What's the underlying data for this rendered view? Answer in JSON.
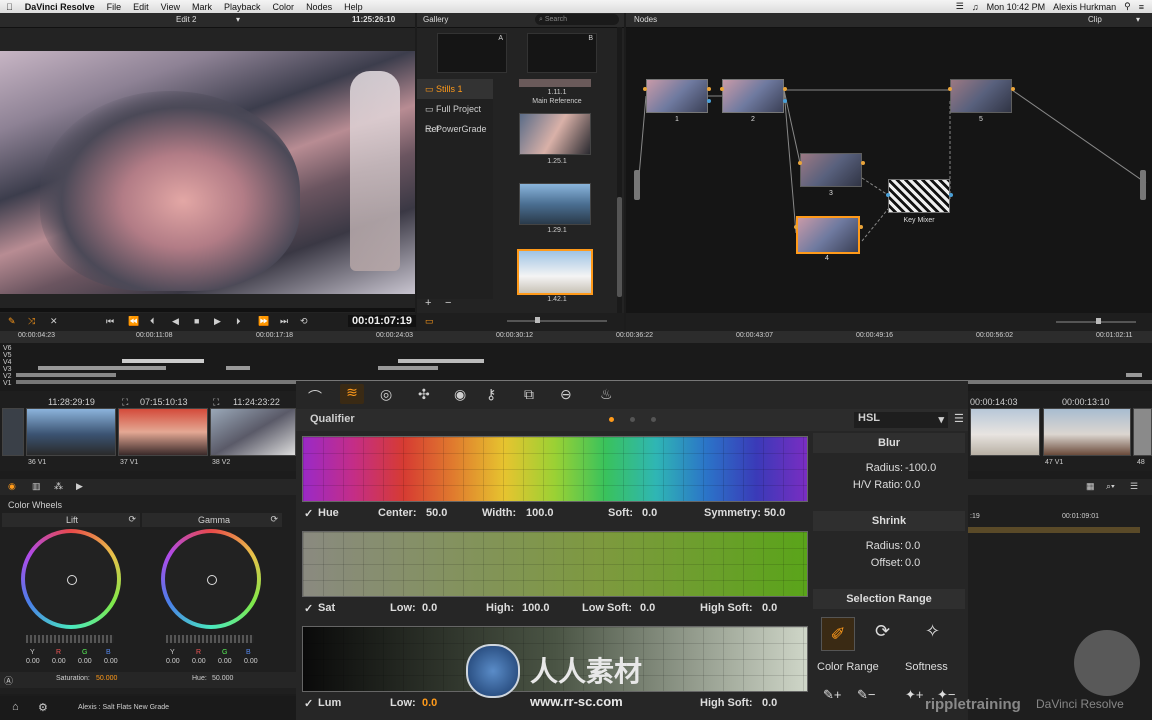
{
  "menubar": {
    "app": "DaVinci Resolve",
    "items": [
      "File",
      "Edit",
      "View",
      "Mark",
      "Playback",
      "Color",
      "Nodes",
      "Help"
    ],
    "clock": "Mon 10:42 PM",
    "user": "Alexis Hurkman"
  },
  "viewer": {
    "edit_name": "Edit 2",
    "timecode_top": "11:25:26:10",
    "timecode_bottom": "00:01:07:19"
  },
  "gallery": {
    "title": "Gallery",
    "search_placeholder": "Search",
    "slot_a": "A",
    "slot_b": "B",
    "albums": [
      "Stills 1",
      "Full Project Ref",
      "PowerGrade"
    ],
    "stills": [
      {
        "id": "1.11.1",
        "label": "Main Reference"
      },
      {
        "id": "1.25.1",
        "label": ""
      },
      {
        "id": "1.29.1",
        "label": ""
      },
      {
        "id": "1.42.1",
        "label": ""
      }
    ],
    "add": "+",
    "remove": "−"
  },
  "nodes": {
    "title": "Nodes",
    "mode": "Clip",
    "labels": [
      "1",
      "2",
      "3",
      "4",
      "5",
      "Key Mixer"
    ]
  },
  "timeline": {
    "ruler": [
      "00:00:04:23",
      "00:00:11:08",
      "00:00:17:18",
      "00:00:24:03",
      "00:00:30:12",
      "00:00:36:22",
      "00:00:43:07",
      "00:00:49:16",
      "00:00:56:02",
      "00:01:02:11"
    ],
    "tracks": [
      "V6",
      "V5",
      "V4",
      "V3",
      "V2",
      "V1"
    ]
  },
  "clips": [
    {
      "tc": "11:28:29:19",
      "label": "36  V1"
    },
    {
      "tc": "07:15:10:13",
      "label": "37  V1"
    },
    {
      "tc": "11:24:23:22",
      "label": "38  V2"
    },
    {
      "tc": "00:00:14:03",
      "label": ""
    },
    {
      "tc": "00:00:13:10",
      "label": "47  V1"
    },
    {
      "tc": "",
      "label": "48"
    }
  ],
  "color_wheels": {
    "title": "Color Wheels",
    "wheels": [
      {
        "name": "Lift",
        "y": "0.00",
        "r": "0.00",
        "g": "0.00",
        "b": "0.00"
      },
      {
        "name": "Gamma",
        "y": "0.00",
        "r": "0.00",
        "g": "0.00",
        "b": "0.00"
      }
    ],
    "ch_y": "Y",
    "ch_r": "R",
    "ch_g": "G",
    "ch_b": "B",
    "saturation_label": "Saturation:",
    "saturation_value": "50.000",
    "hue_label": "Hue:",
    "hue_value": "50.000"
  },
  "status": {
    "text": "Alexis : Salt Flats New Grade"
  },
  "qualifier": {
    "title": "Qualifier",
    "mode": "HSL",
    "hue": {
      "label": "Hue",
      "center_label": "Center:",
      "center": "50.0",
      "width_label": "Width:",
      "width": "100.0",
      "soft_label": "Soft:",
      "soft": "0.0",
      "sym_label": "Symmetry:",
      "sym": "50.0"
    },
    "sat": {
      "label": "Sat",
      "low_label": "Low:",
      "low": "0.0",
      "high_label": "High:",
      "high": "100.0",
      "lowsoft_label": "Low Soft:",
      "lowsoft": "0.0",
      "highsoft_label": "High Soft:",
      "highsoft": "0.0"
    },
    "lum": {
      "label": "Lum",
      "low_label": "Low:",
      "low": "0.0",
      "highsoft_label": "High Soft:",
      "highsoft": "0.0"
    },
    "blur": {
      "title": "Blur",
      "radius_label": "Radius:",
      "radius": "-100.0",
      "hv_label": "H/V Ratio:",
      "hv": "0.0"
    },
    "shrink": {
      "title": "Shrink",
      "radius_label": "Radius:",
      "radius": "0.0",
      "offset_label": "Offset:",
      "offset": "0.0"
    },
    "selection": {
      "title": "Selection Range",
      "color_range": "Color Range",
      "softness": "Softness"
    }
  },
  "right_panel": {
    "tc": "00:01:09:01",
    "tc2": ":19"
  },
  "watermark": {
    "cn": "人人素材",
    "url": "www.rr-sc.com",
    "brand": "rippletraining",
    "app": "DaVinci Resolve"
  }
}
